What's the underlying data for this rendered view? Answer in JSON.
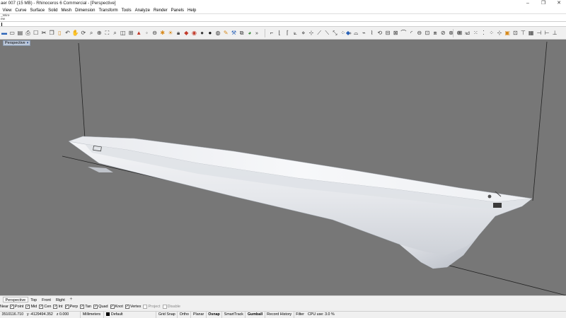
{
  "window": {
    "title": "aer 007 (15 MB) - Rhinoceros 6 Commercial - [Perspective]",
    "controls": [
      "–",
      "❐",
      "✕"
    ]
  },
  "menu": [
    "View",
    "Curve",
    "Surface",
    "Solid",
    "Mesh",
    "Dimension",
    "Transform",
    "Tools",
    "Analyze",
    "Render",
    "Panels",
    "Help"
  ],
  "command_history": [
    "_Wire",
    "ew"
  ],
  "toolbar": {
    "overflow_glyph": "»"
  },
  "viewport": {
    "tab_label": "Perspective",
    "tab_arrow": "▾",
    "background": "#777777",
    "model_color": "#e9ecef"
  },
  "view_tabs": [
    "Perspective",
    "Top",
    "Front",
    "Right"
  ],
  "view_tab_add": "+",
  "osnap": {
    "label": "Near",
    "items": [
      {
        "label": "Point",
        "checked": true
      },
      {
        "label": "Mid",
        "checked": true
      },
      {
        "label": "Cen",
        "checked": true
      },
      {
        "label": "Int",
        "checked": true
      },
      {
        "label": "Perp",
        "checked": true
      },
      {
        "label": "Tan",
        "checked": true
      },
      {
        "label": "Quad",
        "checked": true
      },
      {
        "label": "Knot",
        "checked": true
      },
      {
        "label": "Vertex",
        "checked": true
      },
      {
        "label": "Project",
        "checked": false
      },
      {
        "label": "Disable",
        "checked": false
      }
    ]
  },
  "status": {
    "x": "3510116.710",
    "y": "y -4129494.352",
    "z": "z 0.000",
    "units": "Millimeters",
    "layer": "Default",
    "grid_snap": "Grid Snap",
    "ortho": "Ortho",
    "planar": "Planar",
    "osnap": "Osnap",
    "smarttrack": "SmartTrack",
    "gumball": "Gumball",
    "record_history": "Record History",
    "filter": "Filter",
    "cpu": "CPU use: 3.0 %"
  }
}
